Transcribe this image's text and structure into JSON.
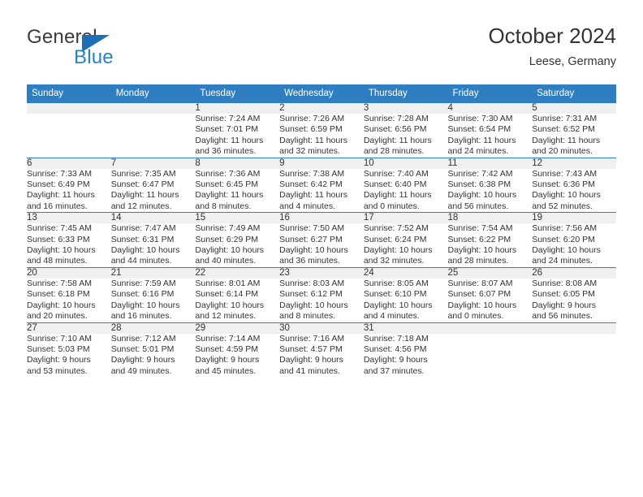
{
  "brand": {
    "name_top": "General",
    "name_bottom": "Blue",
    "triangle_color": "#1f6fb4",
    "blue_text_color": "#2384c6"
  },
  "header": {
    "title": "October 2024",
    "subtitle": "Leese, Germany"
  },
  "theme": {
    "header_blue": "#2f7ec1",
    "daynum_band": "#f0f0f0",
    "text": "#333333"
  },
  "columns": [
    "Sunday",
    "Monday",
    "Tuesday",
    "Wednesday",
    "Thursday",
    "Friday",
    "Saturday"
  ],
  "labels": {
    "sunrise": "Sunrise:",
    "sunset": "Sunset:",
    "daylight": "Daylight:"
  },
  "weeks": [
    [
      {
        "day": "",
        "sunrise": "",
        "sunset": "",
        "daylight_1": "",
        "daylight_2": ""
      },
      {
        "day": "",
        "sunrise": "",
        "sunset": "",
        "daylight_1": "",
        "daylight_2": ""
      },
      {
        "day": "1",
        "sunrise": "Sunrise: 7:24 AM",
        "sunset": "Sunset: 7:01 PM",
        "daylight_1": "Daylight: 11 hours",
        "daylight_2": "and 36 minutes."
      },
      {
        "day": "2",
        "sunrise": "Sunrise: 7:26 AM",
        "sunset": "Sunset: 6:59 PM",
        "daylight_1": "Daylight: 11 hours",
        "daylight_2": "and 32 minutes."
      },
      {
        "day": "3",
        "sunrise": "Sunrise: 7:28 AM",
        "sunset": "Sunset: 6:56 PM",
        "daylight_1": "Daylight: 11 hours",
        "daylight_2": "and 28 minutes."
      },
      {
        "day": "4",
        "sunrise": "Sunrise: 7:30 AM",
        "sunset": "Sunset: 6:54 PM",
        "daylight_1": "Daylight: 11 hours",
        "daylight_2": "and 24 minutes."
      },
      {
        "day": "5",
        "sunrise": "Sunrise: 7:31 AM",
        "sunset": "Sunset: 6:52 PM",
        "daylight_1": "Daylight: 11 hours",
        "daylight_2": "and 20 minutes."
      }
    ],
    [
      {
        "day": "6",
        "sunrise": "Sunrise: 7:33 AM",
        "sunset": "Sunset: 6:49 PM",
        "daylight_1": "Daylight: 11 hours",
        "daylight_2": "and 16 minutes."
      },
      {
        "day": "7",
        "sunrise": "Sunrise: 7:35 AM",
        "sunset": "Sunset: 6:47 PM",
        "daylight_1": "Daylight: 11 hours",
        "daylight_2": "and 12 minutes."
      },
      {
        "day": "8",
        "sunrise": "Sunrise: 7:36 AM",
        "sunset": "Sunset: 6:45 PM",
        "daylight_1": "Daylight: 11 hours",
        "daylight_2": "and 8 minutes."
      },
      {
        "day": "9",
        "sunrise": "Sunrise: 7:38 AM",
        "sunset": "Sunset: 6:42 PM",
        "daylight_1": "Daylight: 11 hours",
        "daylight_2": "and 4 minutes."
      },
      {
        "day": "10",
        "sunrise": "Sunrise: 7:40 AM",
        "sunset": "Sunset: 6:40 PM",
        "daylight_1": "Daylight: 11 hours",
        "daylight_2": "and 0 minutes."
      },
      {
        "day": "11",
        "sunrise": "Sunrise: 7:42 AM",
        "sunset": "Sunset: 6:38 PM",
        "daylight_1": "Daylight: 10 hours",
        "daylight_2": "and 56 minutes."
      },
      {
        "day": "12",
        "sunrise": "Sunrise: 7:43 AM",
        "sunset": "Sunset: 6:36 PM",
        "daylight_1": "Daylight: 10 hours",
        "daylight_2": "and 52 minutes."
      }
    ],
    [
      {
        "day": "13",
        "sunrise": "Sunrise: 7:45 AM",
        "sunset": "Sunset: 6:33 PM",
        "daylight_1": "Daylight: 10 hours",
        "daylight_2": "and 48 minutes."
      },
      {
        "day": "14",
        "sunrise": "Sunrise: 7:47 AM",
        "sunset": "Sunset: 6:31 PM",
        "daylight_1": "Daylight: 10 hours",
        "daylight_2": "and 44 minutes."
      },
      {
        "day": "15",
        "sunrise": "Sunrise: 7:49 AM",
        "sunset": "Sunset: 6:29 PM",
        "daylight_1": "Daylight: 10 hours",
        "daylight_2": "and 40 minutes."
      },
      {
        "day": "16",
        "sunrise": "Sunrise: 7:50 AM",
        "sunset": "Sunset: 6:27 PM",
        "daylight_1": "Daylight: 10 hours",
        "daylight_2": "and 36 minutes."
      },
      {
        "day": "17",
        "sunrise": "Sunrise: 7:52 AM",
        "sunset": "Sunset: 6:24 PM",
        "daylight_1": "Daylight: 10 hours",
        "daylight_2": "and 32 minutes."
      },
      {
        "day": "18",
        "sunrise": "Sunrise: 7:54 AM",
        "sunset": "Sunset: 6:22 PM",
        "daylight_1": "Daylight: 10 hours",
        "daylight_2": "and 28 minutes."
      },
      {
        "day": "19",
        "sunrise": "Sunrise: 7:56 AM",
        "sunset": "Sunset: 6:20 PM",
        "daylight_1": "Daylight: 10 hours",
        "daylight_2": "and 24 minutes."
      }
    ],
    [
      {
        "day": "20",
        "sunrise": "Sunrise: 7:58 AM",
        "sunset": "Sunset: 6:18 PM",
        "daylight_1": "Daylight: 10 hours",
        "daylight_2": "and 20 minutes."
      },
      {
        "day": "21",
        "sunrise": "Sunrise: 7:59 AM",
        "sunset": "Sunset: 6:16 PM",
        "daylight_1": "Daylight: 10 hours",
        "daylight_2": "and 16 minutes."
      },
      {
        "day": "22",
        "sunrise": "Sunrise: 8:01 AM",
        "sunset": "Sunset: 6:14 PM",
        "daylight_1": "Daylight: 10 hours",
        "daylight_2": "and 12 minutes."
      },
      {
        "day": "23",
        "sunrise": "Sunrise: 8:03 AM",
        "sunset": "Sunset: 6:12 PM",
        "daylight_1": "Daylight: 10 hours",
        "daylight_2": "and 8 minutes."
      },
      {
        "day": "24",
        "sunrise": "Sunrise: 8:05 AM",
        "sunset": "Sunset: 6:10 PM",
        "daylight_1": "Daylight: 10 hours",
        "daylight_2": "and 4 minutes."
      },
      {
        "day": "25",
        "sunrise": "Sunrise: 8:07 AM",
        "sunset": "Sunset: 6:07 PM",
        "daylight_1": "Daylight: 10 hours",
        "daylight_2": "and 0 minutes."
      },
      {
        "day": "26",
        "sunrise": "Sunrise: 8:08 AM",
        "sunset": "Sunset: 6:05 PM",
        "daylight_1": "Daylight: 9 hours",
        "daylight_2": "and 56 minutes."
      }
    ],
    [
      {
        "day": "27",
        "sunrise": "Sunrise: 7:10 AM",
        "sunset": "Sunset: 5:03 PM",
        "daylight_1": "Daylight: 9 hours",
        "daylight_2": "and 53 minutes."
      },
      {
        "day": "28",
        "sunrise": "Sunrise: 7:12 AM",
        "sunset": "Sunset: 5:01 PM",
        "daylight_1": "Daylight: 9 hours",
        "daylight_2": "and 49 minutes."
      },
      {
        "day": "29",
        "sunrise": "Sunrise: 7:14 AM",
        "sunset": "Sunset: 4:59 PM",
        "daylight_1": "Daylight: 9 hours",
        "daylight_2": "and 45 minutes."
      },
      {
        "day": "30",
        "sunrise": "Sunrise: 7:16 AM",
        "sunset": "Sunset: 4:57 PM",
        "daylight_1": "Daylight: 9 hours",
        "daylight_2": "and 41 minutes."
      },
      {
        "day": "31",
        "sunrise": "Sunrise: 7:18 AM",
        "sunset": "Sunset: 4:56 PM",
        "daylight_1": "Daylight: 9 hours",
        "daylight_2": "and 37 minutes."
      },
      {
        "day": "",
        "sunrise": "",
        "sunset": "",
        "daylight_1": "",
        "daylight_2": ""
      },
      {
        "day": "",
        "sunrise": "",
        "sunset": "",
        "daylight_1": "",
        "daylight_2": ""
      }
    ]
  ]
}
